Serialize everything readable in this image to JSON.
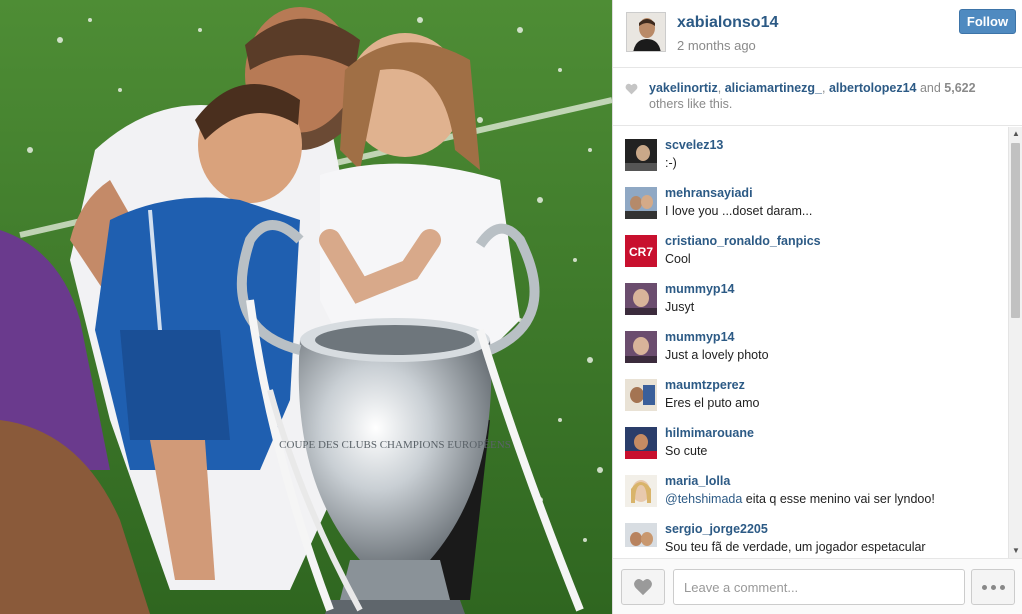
{
  "post": {
    "username": "xabialonso14",
    "time_ago": "2 months ago",
    "follow_label": "Follow"
  },
  "likes": {
    "users": [
      "yakelinortiz",
      "aliciamartinezg_",
      "albertolopez14"
    ],
    "sep1": ", ",
    "sep2": ", ",
    "and_text": " and ",
    "count": "5,622",
    "suffix": "others like this."
  },
  "comments": [
    {
      "user": "scvelez13",
      "text": ":-)"
    },
    {
      "user": "mehransayiadi",
      "text": "I love you ...doset daram..."
    },
    {
      "user": "cristiano_ronaldo_fanpics",
      "text": "Cool"
    },
    {
      "user": "mummyp14",
      "text": "Jusyt"
    },
    {
      "user": "mummyp14",
      "text": "Just a lovely photo"
    },
    {
      "user": "maumtzperez",
      "text": "Eres el puto amo"
    },
    {
      "user": "hilmimarouane",
      "text": "So cute"
    },
    {
      "user": "maria_lolla",
      "mention": "@tehshimada",
      "text": " eita q esse menino vai ser lyndoo!"
    },
    {
      "user": "sergio_jorge2205",
      "text": "Sou teu fã de verdade, um jogador espetacular"
    }
  ],
  "footer": {
    "comment_placeholder": "Leave a comment..."
  },
  "photo": {
    "trophy_inscription": "COUPE DES CLUBS CHAMPIONS EUROPÉENS"
  },
  "colors": {
    "link": "#2c5a85",
    "follow_button": "#4f8ac0",
    "grass": "#3f7a2c"
  }
}
